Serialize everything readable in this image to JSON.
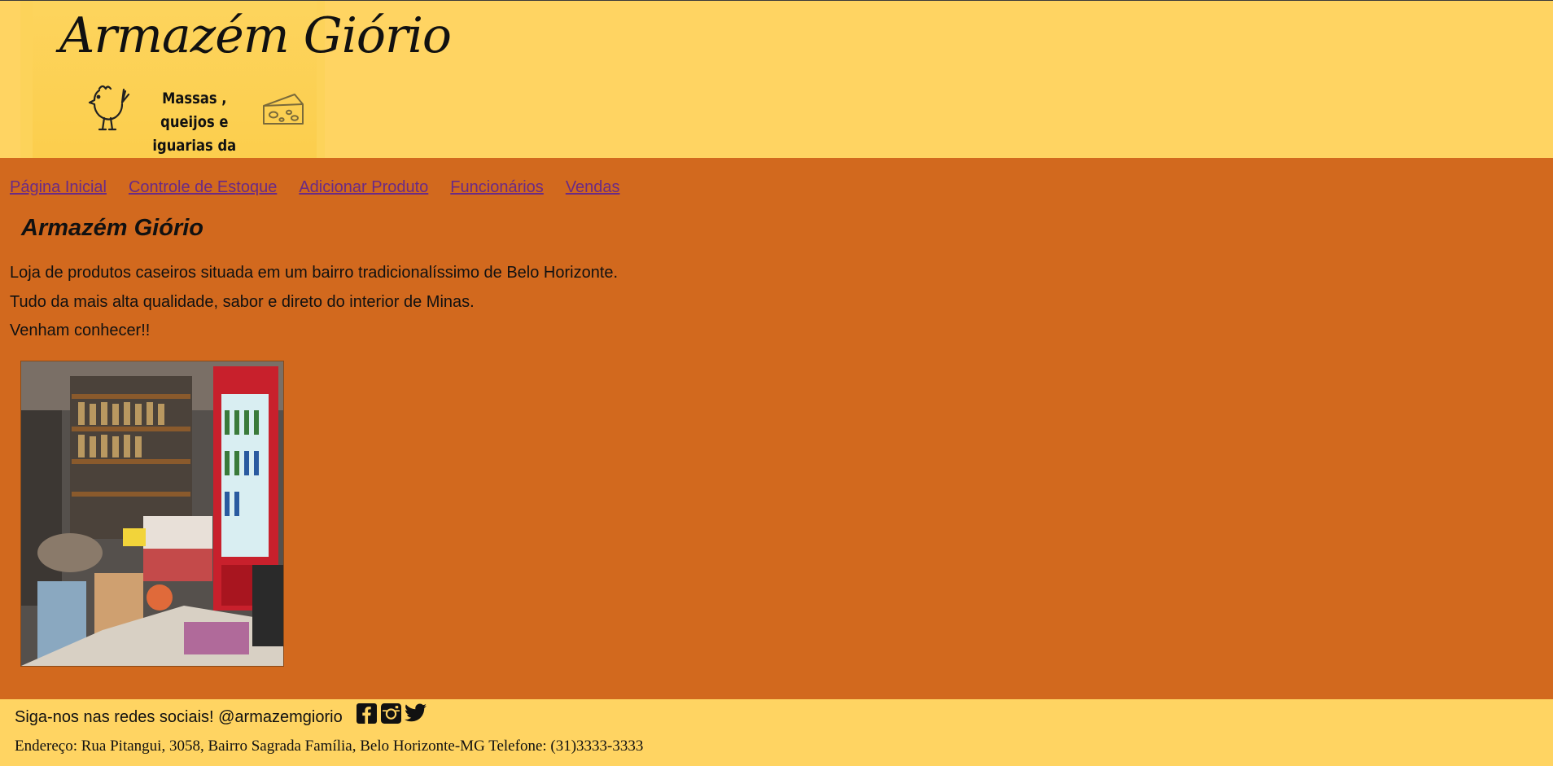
{
  "header": {
    "logo": {
      "script_text": "Armazém Giório",
      "tagline_line1": "Massas , queijos e",
      "tagline_line2": "iguarias da roça"
    }
  },
  "nav": {
    "items": [
      "Página Inicial",
      "Controle de Estoque",
      "Adicionar Produto",
      "Funcionários",
      "Vendas"
    ]
  },
  "main": {
    "title": "Armazém Giório",
    "description": [
      "Loja de produtos caseiros situada em um bairro tradicionalíssimo de Belo Horizonte.",
      "Tudo da mais alta qualidade, sabor e direto do interior de Minas.",
      "Venham conhecer!!"
    ]
  },
  "footer": {
    "social_text": "Siga-nos nas redes sociais! @armazemgiorio",
    "social_icons": [
      "facebook-icon",
      "instagram-icon",
      "twitter-icon"
    ],
    "address": "Endereço: Rua Pitangui, 3058, Bairro Sagrada Família, Belo Horizonte-MG Telefone: (31)3333-3333"
  },
  "colors": {
    "header_bg": "#ffd462",
    "main_bg": "#d2691e",
    "link": "#6a2a86",
    "text": "#111111"
  }
}
